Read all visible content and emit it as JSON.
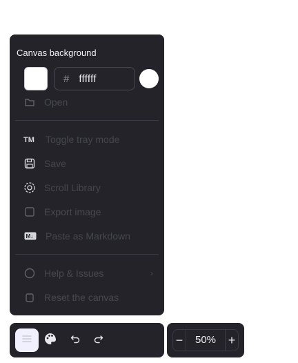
{
  "menu": {
    "items": [
      {
        "label": "Open",
        "icon": "folder-icon"
      },
      {
        "label": "Toggle tray mode",
        "icon": "tm-icon"
      },
      {
        "label": "Save",
        "icon": "save-icon"
      },
      {
        "label": "Scroll Library",
        "icon": "library-icon"
      },
      {
        "label": "Export image",
        "icon": "export-icon"
      },
      {
        "label": "Paste as Markdown",
        "icon": "markdown-icon"
      },
      {
        "label": "Help & Issues",
        "icon": "help-icon"
      },
      {
        "label": "Reset the canvas",
        "icon": "trash-icon"
      }
    ]
  },
  "background_picker": {
    "title": "Canvas background",
    "hash": "#",
    "hex_value": "ffffff",
    "color": "#ffffff"
  },
  "zoom": {
    "value": "50%",
    "minus": "−",
    "plus": "+"
  }
}
